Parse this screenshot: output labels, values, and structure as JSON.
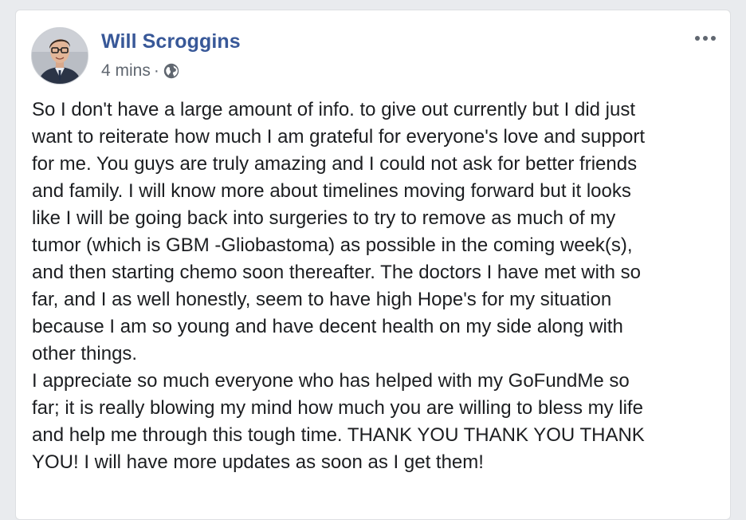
{
  "post": {
    "author": "Will Scroggins",
    "timestamp": "4 mins",
    "separator": "·",
    "privacy_icon": "globe-icon",
    "more_icon": "more-horizontal-icon",
    "paragraphs": [
      "So I don't have a large amount of info. to give out currently but I did just\nwant to reiterate how much I am grateful for everyone's love and support\nfor me. You guys are truly amazing and I could not ask for better friends\nand family. I will know more about timelines moving forward but it looks\nlike I will be going back into surgeries to try to remove as much of my\ntumor (which is GBM -Gliobastoma) as possible in the coming week(s),\nand then starting chemo soon thereafter. The doctors I have met with so\nfar, and I as well honestly, seem to have high Hope's for my situation\nbecause I am so young and have decent health on my side along with\nother things.",
      "I appreciate so much everyone who has helped with my GoFundMe so\nfar; it is really blowing my mind how much you are willing to bless my life\nand help me through this tough time. THANK YOU THANK YOU THANK\nYOU! I will have more updates as soon as I get them!"
    ]
  },
  "colors": {
    "author_name": "#385898",
    "meta_text": "#606770",
    "body_text": "#1c1e21",
    "page_background": "#e9ebee",
    "card_background": "#ffffff"
  }
}
